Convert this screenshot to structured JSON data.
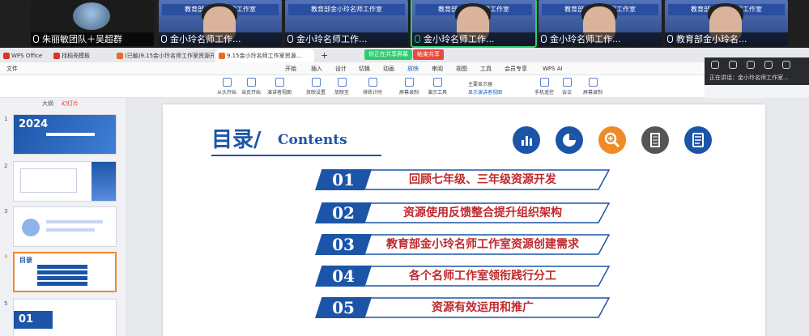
{
  "participants": [
    {
      "name": "朱丽敏团队＋吴超群"
    },
    {
      "name": "金小玲名师工作..."
    },
    {
      "name": "金小玲名师工作..."
    },
    {
      "name": "金小玲名师工作..."
    },
    {
      "name": "金小玲名师工作..."
    },
    {
      "name": "教育部金小玲名..."
    }
  ],
  "tile_banner": "教育部金小玲名师工作室",
  "tabs": [
    "WPS Office",
    "找稻壳模板",
    "(已編)9.15金小玲名师工作室资源开...",
    "9.15金小玲名师工作室资源..."
  ],
  "share_indicator": "你正在共享屏幕",
  "exit_share": "结束共享",
  "menus": [
    "文件",
    "开始",
    "插入",
    "设计",
    "切换",
    "动画",
    "放映",
    "审阅",
    "视图",
    "工具",
    "会员专享"
  ],
  "wps_ai": "WPS AI",
  "ribbon": [
    "从头开始",
    "当页开始",
    "演讲者视图",
    "放映设置",
    "放映至",
    "排练计时",
    "屏幕录制",
    "演示工具",
    "显示演讲者视图",
    "手机遥控",
    "会议",
    "屏幕录制"
  ],
  "ribbon_select": "主要显示器",
  "mini_window": {
    "text": "正在讲话：金小玲名师工作室..."
  },
  "thumb_panel": {
    "header": "大纲",
    "tab2": "幻灯片"
  },
  "thumbs": [
    {
      "num": "1",
      "title": "2024"
    },
    {
      "num": "2",
      "title": ""
    },
    {
      "num": "3",
      "title": ""
    },
    {
      "num": "4",
      "title": "目录"
    },
    {
      "num": "5",
      "title": "01"
    }
  ],
  "slide": {
    "title": "目录/",
    "title_en": "Contents",
    "icons": [
      "bar-chart-icon",
      "pie-chart-icon",
      "magnifier-icon",
      "notebook-icon",
      "list-icon"
    ],
    "items": [
      {
        "num": "01",
        "text": "回顾七年级、三年级资源开发"
      },
      {
        "num": "02",
        "text": "资源使用反馈整合提升组织架构"
      },
      {
        "num": "03",
        "text": "教育部金小玲名师工作室资源创建需求"
      },
      {
        "num": "04",
        "text": "各个名师工作室领衔践行分工"
      },
      {
        "num": "05",
        "text": "资源有效运用和推广"
      }
    ]
  },
  "colors": {
    "accent": "#1c55a8",
    "item_text": "#c0282d",
    "speaking": "#2ecc71"
  }
}
